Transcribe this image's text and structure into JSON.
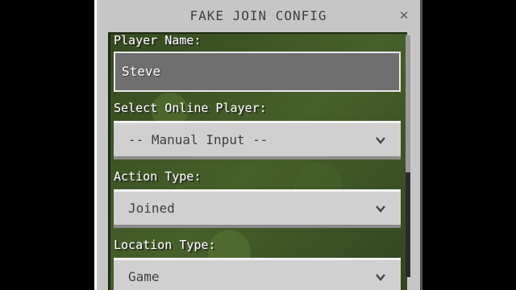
{
  "dialog": {
    "title": "FAKE JOIN CONFIG",
    "close_icon": "close-icon"
  },
  "form": {
    "player_name": {
      "label": "Player Name:",
      "value": "Steve"
    },
    "online_player": {
      "label": "Select Online Player:",
      "selected": "-- Manual Input --",
      "icon": "chevron-down-icon"
    },
    "action_type": {
      "label": "Action Type:",
      "selected": "Joined",
      "icon": "chevron-down-icon"
    },
    "location_type": {
      "label": "Location Type:",
      "selected": "Game",
      "icon": "chevron-down-icon"
    }
  },
  "colors": {
    "panel": "#c6c6c6",
    "background_grass": "#3b4d23",
    "label_text": "#ffffff",
    "dropdown_text": "#3f3f3f"
  }
}
